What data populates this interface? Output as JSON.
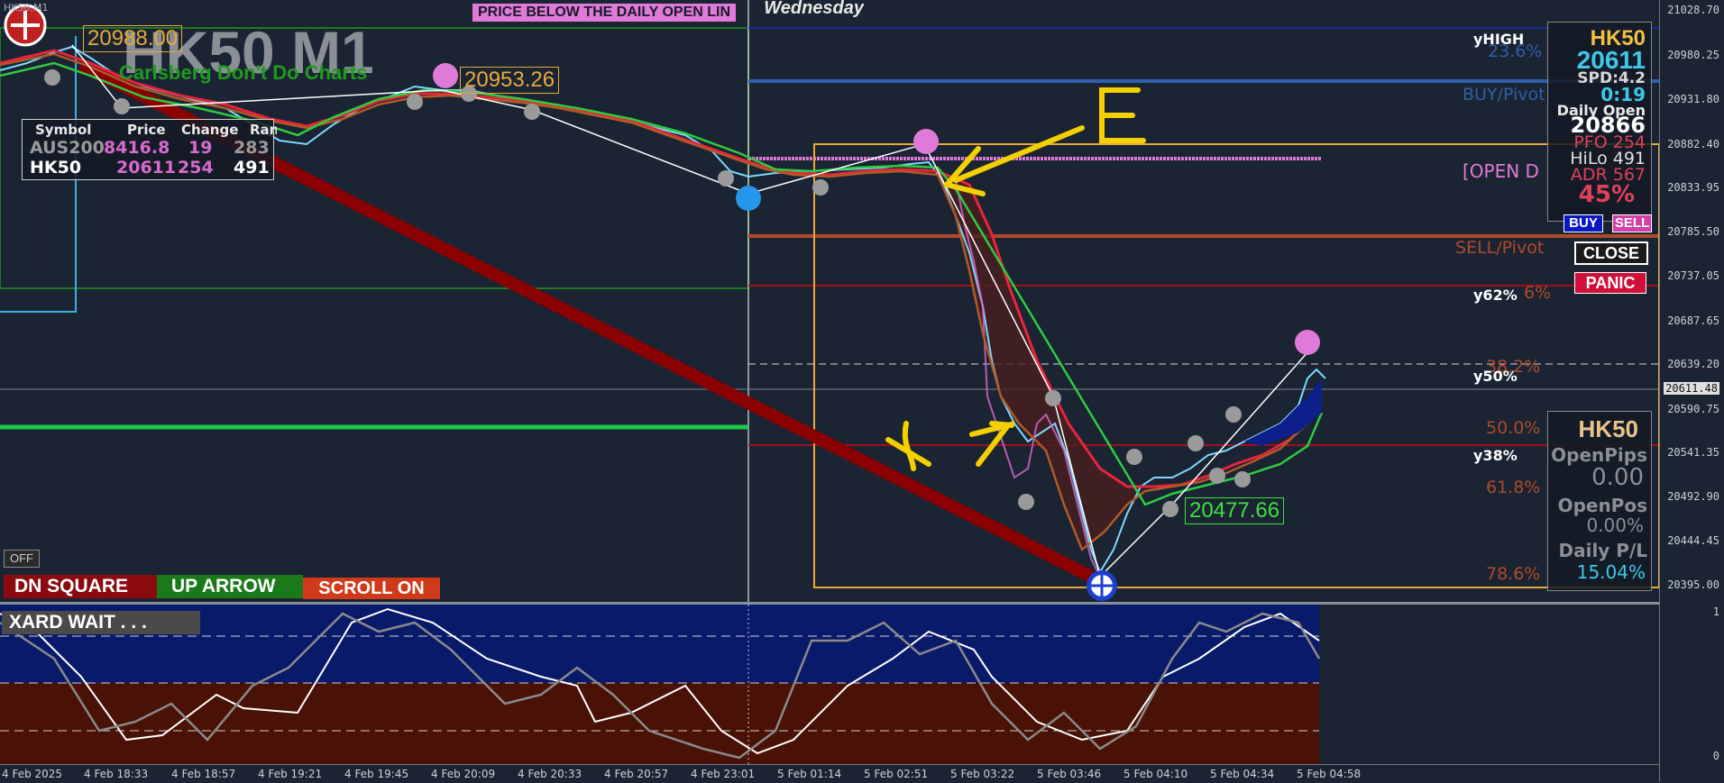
{
  "window": {
    "title_icon": "close-icon",
    "title_text": "HK50,M1"
  },
  "chart": {
    "symbol_title": "HK50 M1",
    "subtitle": "Carlsberg Don't Do Charts",
    "banner": "PRICE BELOW THE DAILY OPEN LIN",
    "day_label": "Wednesday",
    "top_left_price": "20988.00",
    "swing_high_price": "20953.26",
    "swing_low_price": "20477.66",
    "annotation_e": "E",
    "annotation_x": "X"
  },
  "levels": {
    "yhigh": "yHIGH",
    "fib_236": "23.6%",
    "buy_pivot": "BUY/Pivot",
    "open_d": "[OPEN D",
    "sell_pivot": "SELL/Pivot",
    "y62": "y62%",
    "fib_6": "6%",
    "y50": "y50%",
    "fib_382": "38.2%",
    "fib_50": "50.0%",
    "y38": "y38%",
    "fib_618": "61.8%",
    "fib_786": "78.6%"
  },
  "symbol_table": {
    "headers": [
      "Symbol",
      "Price",
      "Change",
      "Range"
    ],
    "rows": [
      [
        "AUS200",
        "8416.8",
        "19",
        "283"
      ],
      [
        "HK50",
        "20611",
        "254",
        "491"
      ]
    ]
  },
  "info_panel": {
    "symbol": "HK50",
    "price": "20611",
    "spread": "SPD:4.2",
    "timer": "0:19",
    "daily_open_label": "Daily Open",
    "daily_open": "20866",
    "pfo": "PFO 254",
    "hilo": "HiLo 491",
    "adr": "ADR 567",
    "adr_pct": "45%"
  },
  "trade_buttons": {
    "buy": "BUY",
    "sell": "SELL",
    "close": "CLOSE",
    "panic": "PANIC"
  },
  "pl_panel": {
    "symbol": "HK50",
    "open_pips_label": "OpenPips",
    "open_pips": "0.00",
    "open_pos_label": "OpenPos",
    "open_pos": "0.00%",
    "daily_pl_label": "Daily P/L",
    "daily_pl": "15.04%"
  },
  "controls": {
    "off": "OFF",
    "dn_square": "DN SQUARE",
    "up_arrow": "UP ARROW",
    "scroll_on": "SCROLL ON",
    "xard_wait": "XARD WAIT . . ."
  },
  "price_axis": [
    "21028.70",
    "20980.25",
    "20931.80",
    "20882.40",
    "20833.95",
    "20785.50",
    "20737.05",
    "20687.65",
    "20639.20",
    "20590.75",
    "20541.35",
    "20492.90",
    "20444.45",
    "20395.00"
  ],
  "current_price_tag": "20611.48",
  "osc_axis": {
    "top": "1",
    "bottom": "0"
  },
  "time_axis": [
    "4 Feb 2025",
    "4 Feb 18:33",
    "4 Feb 18:57",
    "4 Feb 19:21",
    "4 Feb 19:45",
    "4 Feb 20:09",
    "4 Feb 20:33",
    "4 Feb 20:57",
    "4 Feb 23:01",
    "5 Feb 01:14",
    "5 Feb 02:51",
    "5 Feb 03:22",
    "5 Feb 03:46",
    "5 Feb 04:10",
    "5 Feb 04:34",
    "5 Feb 04:58"
  ],
  "colors": {
    "background": "#1a2433",
    "fib_box": "#e8a93a",
    "buy_line": "#2f5fa8",
    "sell_line": "#b04a2a",
    "trend_line": "#8b0000",
    "ema_fast": "#e8243c",
    "ema_slow": "#b05a28",
    "pink_dot": "#e07ad8",
    "yellow_ink": "#f5d000"
  }
}
